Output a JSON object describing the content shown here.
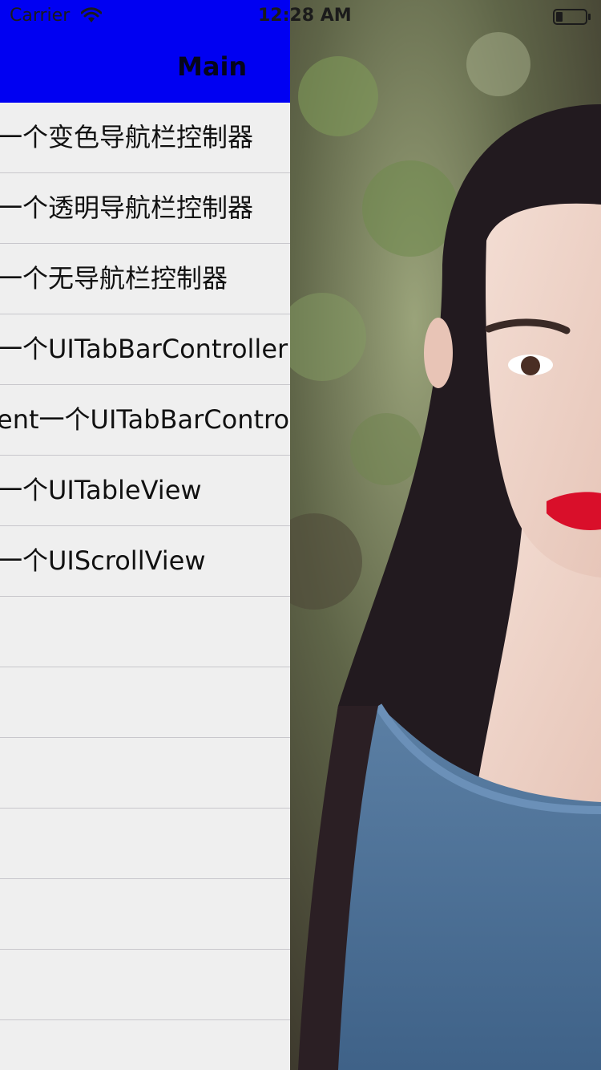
{
  "status_bar": {
    "carrier": "Carrier",
    "time": "12:28 AM",
    "wifi_icon": "wifi-icon",
    "battery_icon": "battery-icon"
  },
  "nav_bar": {
    "title": "Main",
    "background": "#0000f2"
  },
  "menu": {
    "rows": [
      {
        "label": "一个变色导航栏控制器"
      },
      {
        "label": "一个透明导航栏控制器"
      },
      {
        "label": "一个无导航栏控制器"
      },
      {
        "label": "一个UITabBarController"
      },
      {
        "label": "ent一个UITabBarControll"
      },
      {
        "label": "一个UITableView"
      },
      {
        "label": "一个UIScrollView"
      },
      {
        "label": ""
      },
      {
        "label": ""
      },
      {
        "label": ""
      },
      {
        "label": ""
      },
      {
        "label": ""
      },
      {
        "label": ""
      },
      {
        "label": ""
      }
    ]
  },
  "background_photo": {
    "subject": "portrait-photo"
  }
}
